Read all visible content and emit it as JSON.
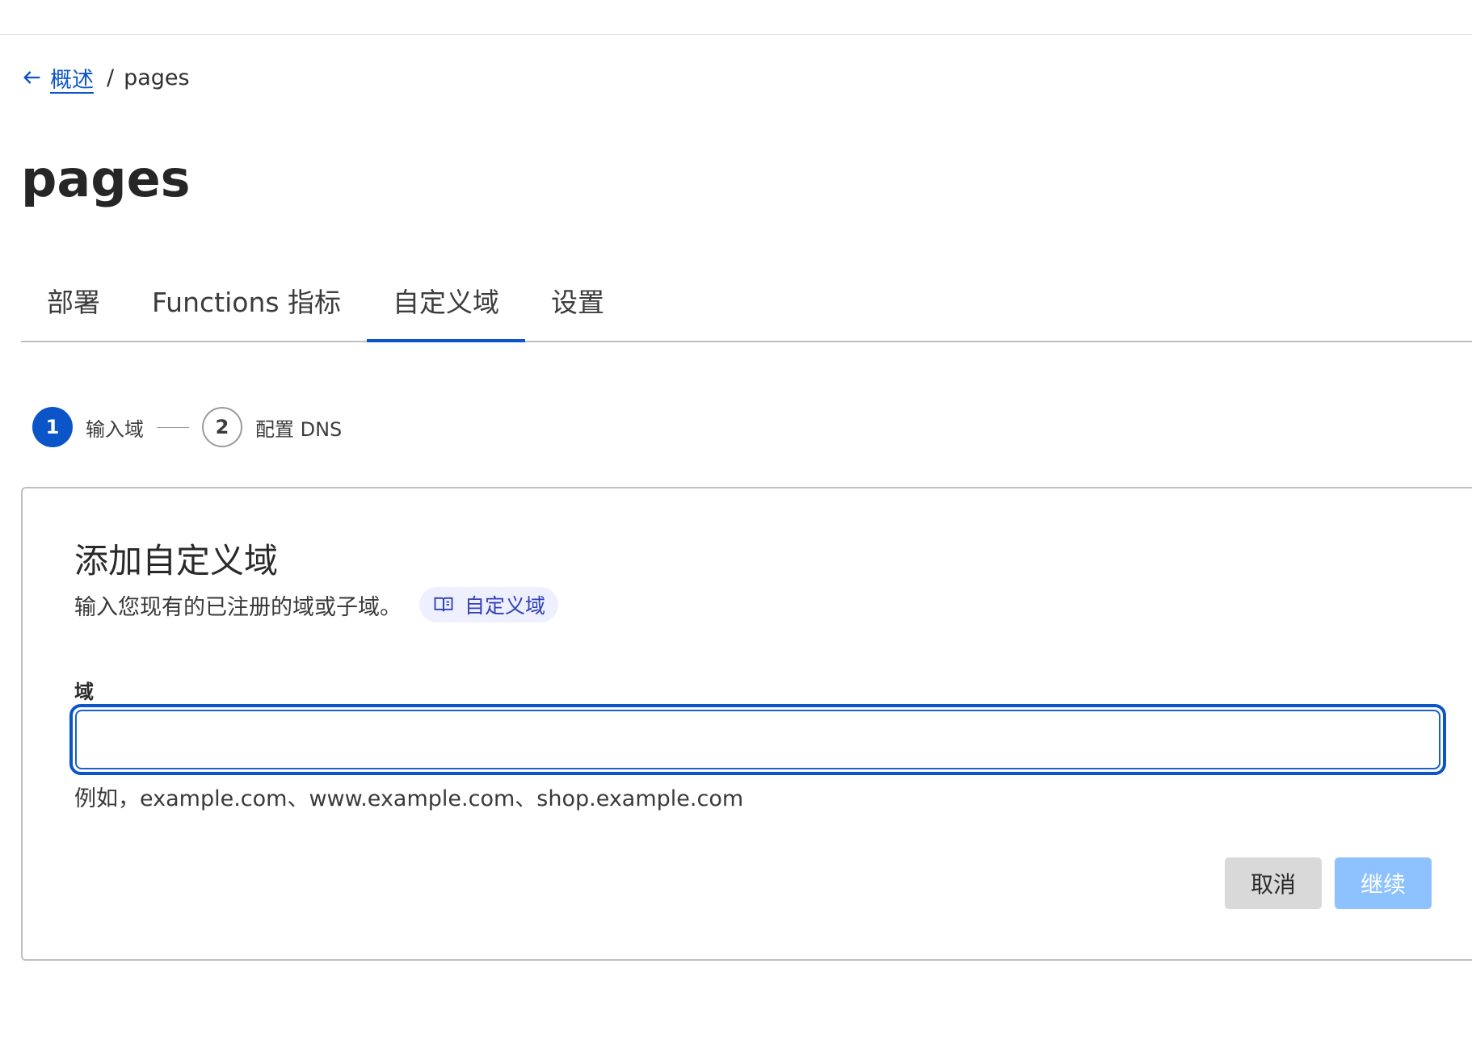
{
  "breadcrumb": {
    "back_label": "概述",
    "separator": "/",
    "current": "pages"
  },
  "page": {
    "title": "pages"
  },
  "tabs": [
    {
      "label": "部署",
      "active": false
    },
    {
      "label": "Functions 指标",
      "active": false
    },
    {
      "label": "自定义域",
      "active": true
    },
    {
      "label": "设置",
      "active": false
    }
  ],
  "stepper": {
    "steps": [
      {
        "number": "1",
        "label": "输入域",
        "active": true
      },
      {
        "number": "2",
        "label": "配置 DNS",
        "active": false
      }
    ]
  },
  "card": {
    "title": "添加自定义域",
    "description": "输入您现有的已注册的域或子域。",
    "doc_link_label": "自定义域",
    "field_label": "域",
    "field_value": "",
    "field_hint": "例如，example.com、www.example.com、shop.example.com",
    "cancel_label": "取消",
    "continue_label": "继续"
  },
  "colors": {
    "accent": "#0b55c9",
    "continue_disabled": "#8ec2ff",
    "cancel_bg": "#d9d9d9",
    "doc_link_bg": "#eeefff"
  }
}
